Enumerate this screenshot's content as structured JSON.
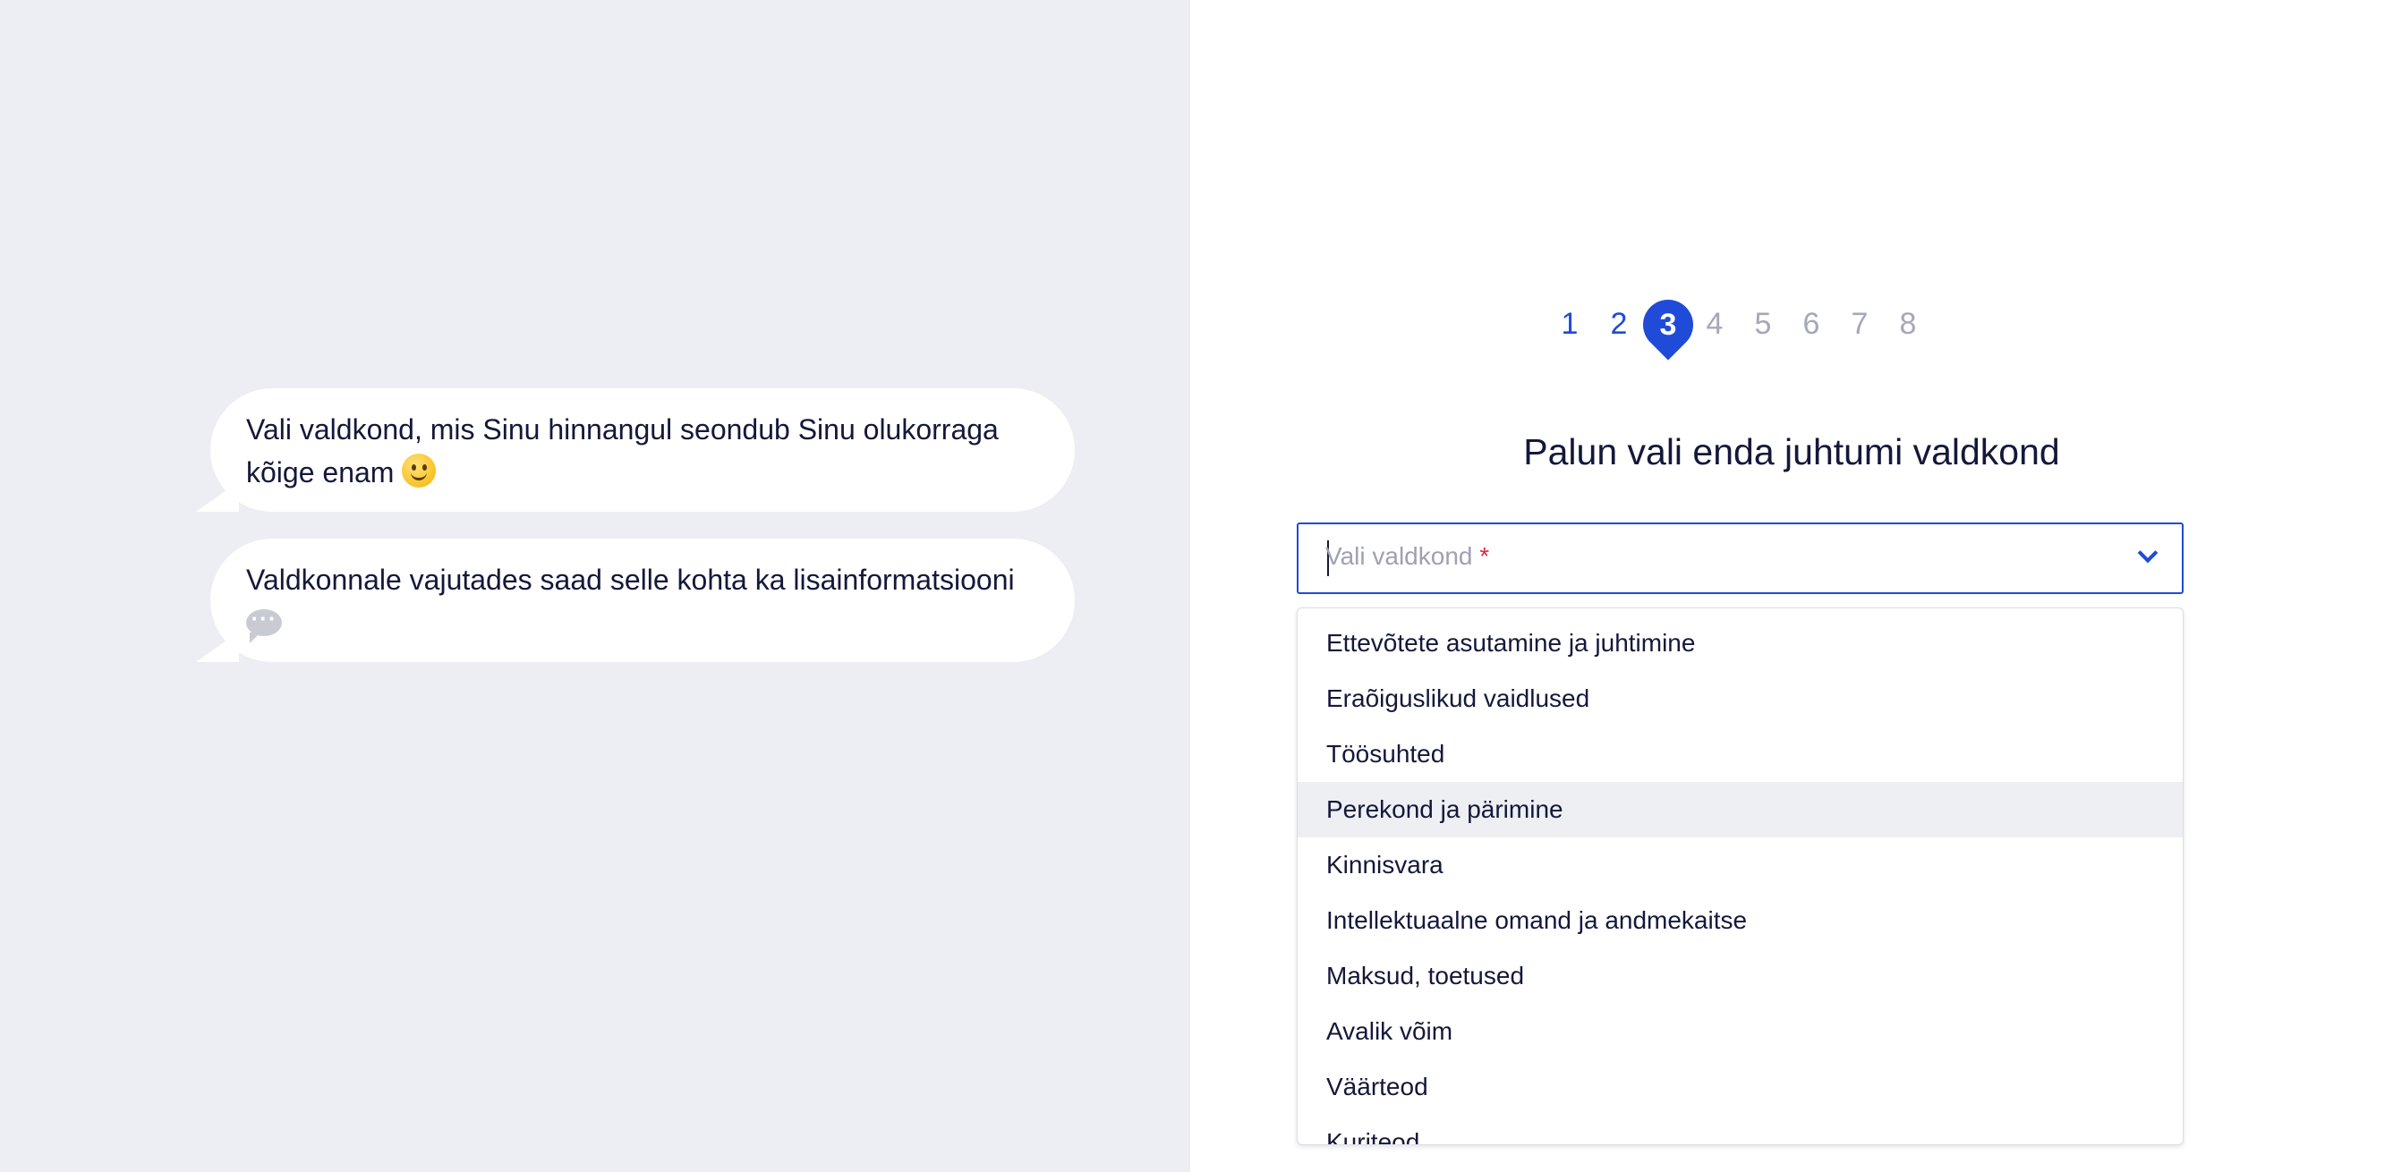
{
  "chat": {
    "messages": [
      {
        "text": "Vali valdkond, mis Sinu hinnangul seondub Sinu olukorraga kõige enam",
        "icon": "smile-emoji-icon"
      },
      {
        "text": "Valdkonnale vajutades saad selle kohta ka lisainformatsiooni",
        "icon": "speech-bubble-icon"
      }
    ]
  },
  "stepper": {
    "steps": [
      "1",
      "2",
      "3",
      "4",
      "5",
      "6",
      "7",
      "8"
    ],
    "current": "3",
    "accent_color": "#1f4bd8",
    "inactive_color": "#a5a8b8"
  },
  "form": {
    "title": "Palun vali enda juhtumi valdkond",
    "select": {
      "placeholder": "Vali valdkond",
      "required_mark": "*",
      "icon": "chevron-down-icon"
    },
    "options": [
      "Ettevõtete asutamine ja juhtimine",
      "Eraõiguslikud vaidlused",
      "Töösuhted",
      "Perekond ja pärimine",
      "Kinnisvara",
      "Intellektuaalne omand ja andmekaitse",
      "Maksud, toetused",
      "Avalik võim",
      "Väärteod",
      "Kuriteod"
    ],
    "highlighted_option": "Perekond ja pärimine"
  },
  "colors": {
    "left_panel_bg": "#edeef3",
    "text": "#14183a",
    "required": "#e0263f"
  }
}
